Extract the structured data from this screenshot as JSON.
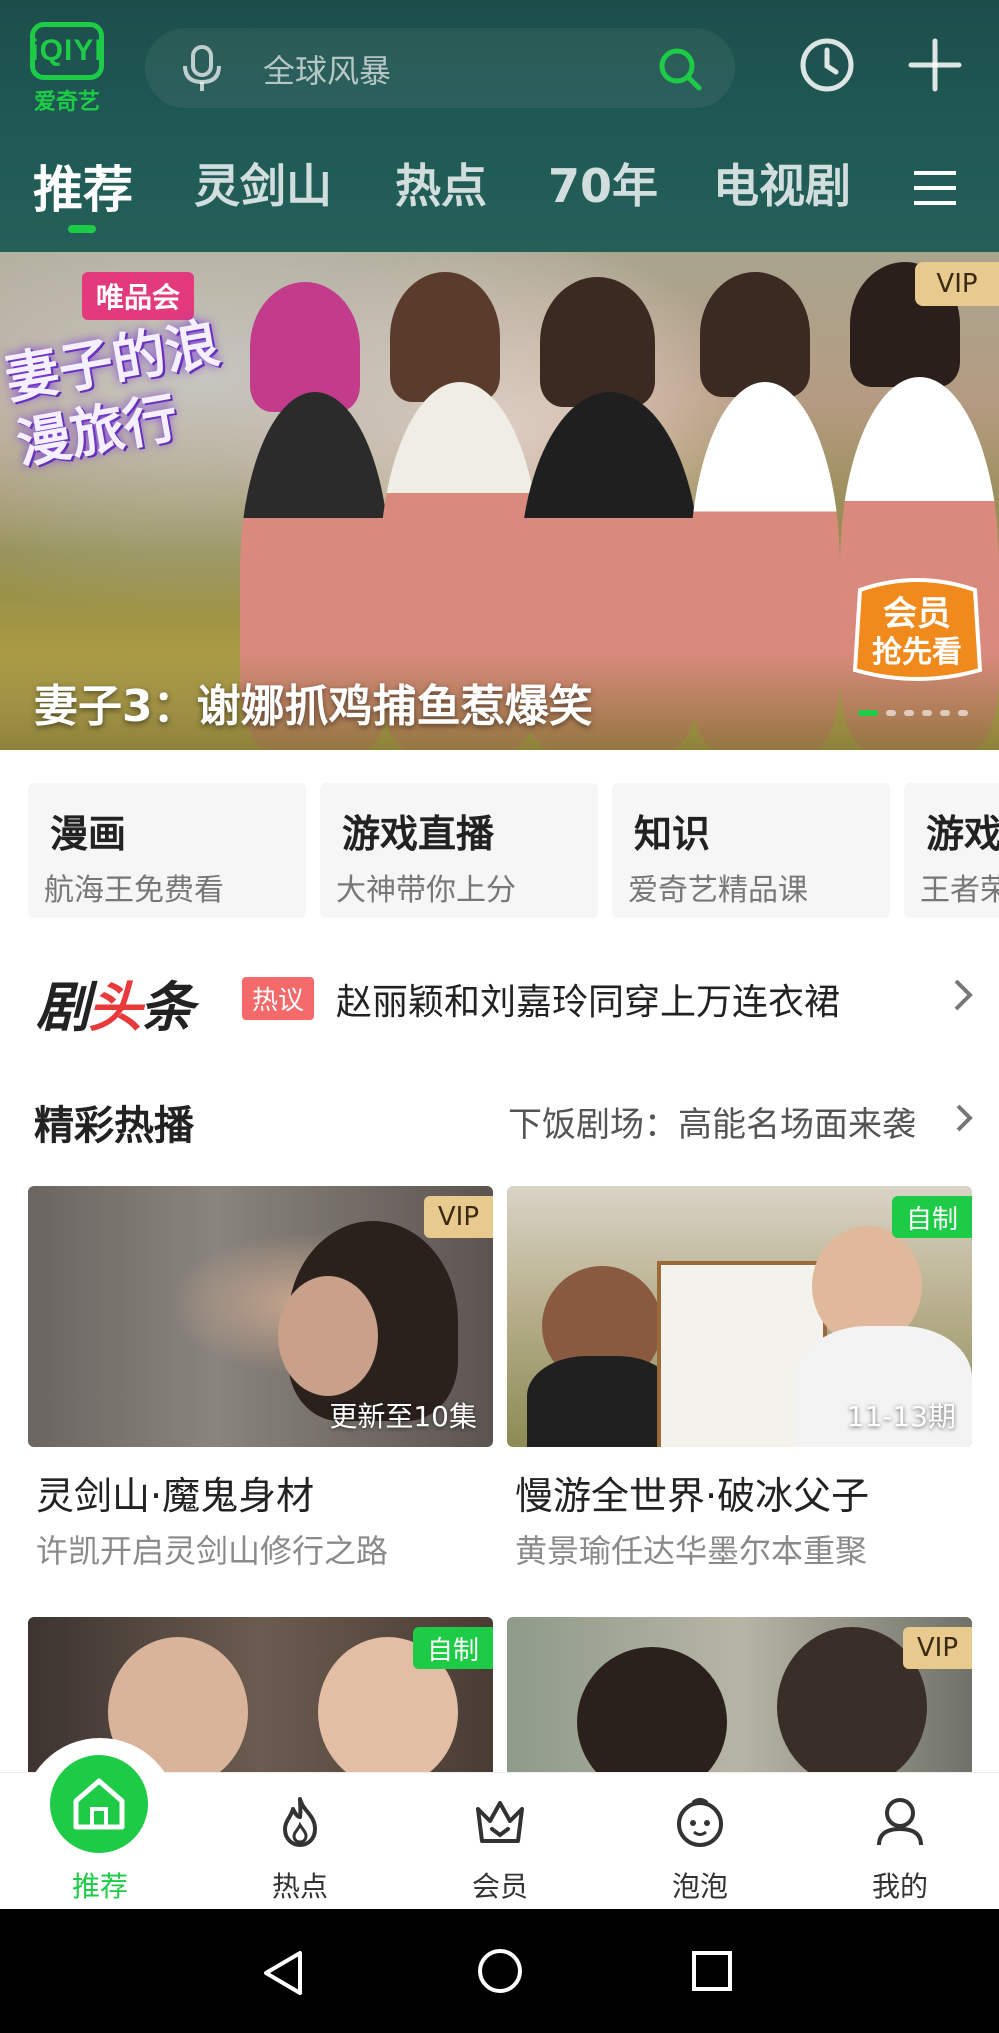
{
  "logo": {
    "mark": "iQIYI",
    "name": "爱奇艺"
  },
  "search": {
    "placeholder": "全球风暴"
  },
  "tabs": [
    {
      "label": "推荐",
      "active": true
    },
    {
      "label": "灵剑山",
      "active": false
    },
    {
      "label": "热点",
      "active": false
    },
    {
      "label": "70年",
      "active": false
    },
    {
      "label": "电视剧",
      "active": false
    }
  ],
  "banner": {
    "vip_badge": "VIP",
    "brand_tag": "唯品会",
    "show_logo": "妻子的浪漫旅行",
    "promo_badge": "会员抢先看",
    "title": "妻子3：谢娜抓鸡捕鱼惹爆笑",
    "slide_count": 6,
    "active_slide": 1
  },
  "categories": [
    {
      "title": "漫画",
      "subtitle": "航海王免费看"
    },
    {
      "title": "游戏直播",
      "subtitle": "大神带你上分"
    },
    {
      "title": "知识",
      "subtitle": "爱奇艺精品课"
    },
    {
      "title": "游戏",
      "subtitle": "王者荣"
    }
  ],
  "headline": {
    "logo_part1": "剧",
    "logo_part2": "头",
    "logo_part3": "条",
    "tag": "热议",
    "text": "赵丽颖和刘嘉玲同穿上万连衣裙"
  },
  "section": {
    "title": "精彩热播",
    "link": "下饭剧场：高能名场面来袭"
  },
  "videos": [
    {
      "badge": "VIP",
      "badge_type": "vip",
      "corner": "更新至10集",
      "title": "灵剑山·魔鬼身材",
      "subtitle": "许凯开启灵剑山修行之路"
    },
    {
      "badge": "自制",
      "badge_type": "self",
      "corner": "11-13期",
      "title": "慢游全世界·破冰父子",
      "subtitle": "黄景瑜任达华墨尔本重聚"
    },
    {
      "badge": "自制",
      "badge_type": "self",
      "corner": "",
      "title": "",
      "subtitle": ""
    },
    {
      "badge": "VIP",
      "badge_type": "vip",
      "corner": "",
      "title": "",
      "subtitle": ""
    }
  ],
  "tabbar": [
    {
      "label": "推荐",
      "icon": "home-icon",
      "active": true
    },
    {
      "label": "热点",
      "icon": "flame-icon",
      "active": false
    },
    {
      "label": "会员",
      "icon": "crown-icon",
      "active": false
    },
    {
      "label": "泡泡",
      "icon": "bubble-face-icon",
      "active": false
    },
    {
      "label": "我的",
      "icon": "person-icon",
      "active": false
    }
  ],
  "colors": {
    "accent": "#1ecb47",
    "vip": "#e8c98e",
    "header_bg": "#1f5a55"
  }
}
